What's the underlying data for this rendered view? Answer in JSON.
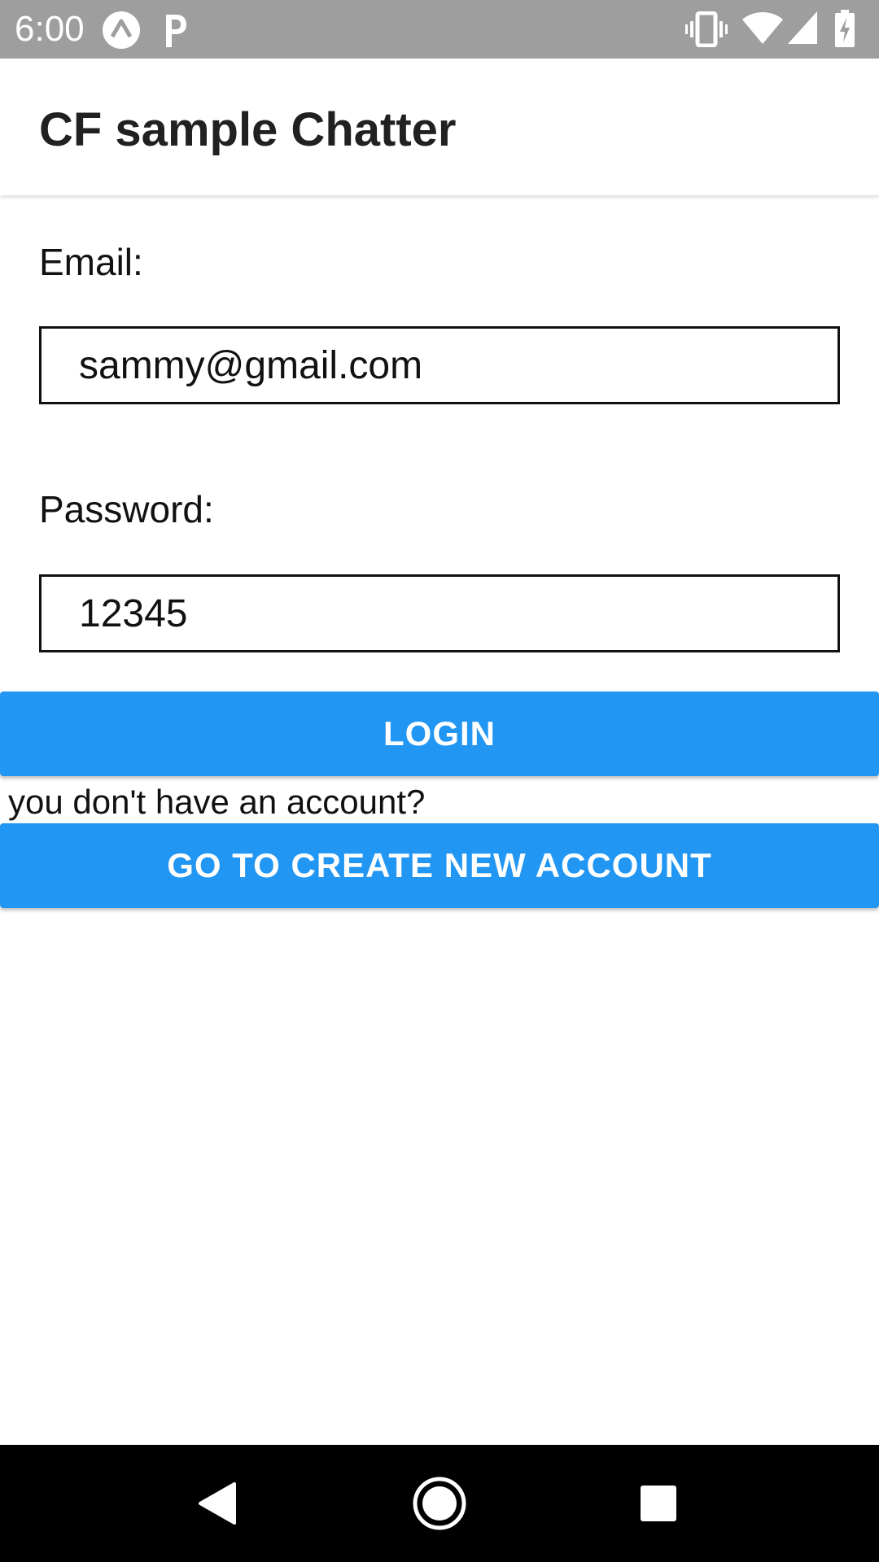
{
  "status_bar": {
    "time": "6:00",
    "icons": [
      "expo-icon",
      "parking-p-icon",
      "vibrate-icon",
      "wifi-icon",
      "signal-icon",
      "battery-charging-icon"
    ]
  },
  "app_bar": {
    "title": "CF sample Chatter"
  },
  "form": {
    "email_label": "Email:",
    "email_value": "sammy@gmail.com",
    "password_label": "Password:",
    "password_value": "12345",
    "login_label": "LOGIN",
    "hint": "you don't have an account?",
    "create_account_label": "GO TO CREATE NEW ACCOUNT"
  },
  "colors": {
    "accent": "#2196f3",
    "status_bar": "#9e9e9e",
    "nav_bar": "#000000"
  },
  "nav_bar": {
    "icons": [
      "back-icon",
      "home-icon",
      "recents-icon"
    ]
  }
}
